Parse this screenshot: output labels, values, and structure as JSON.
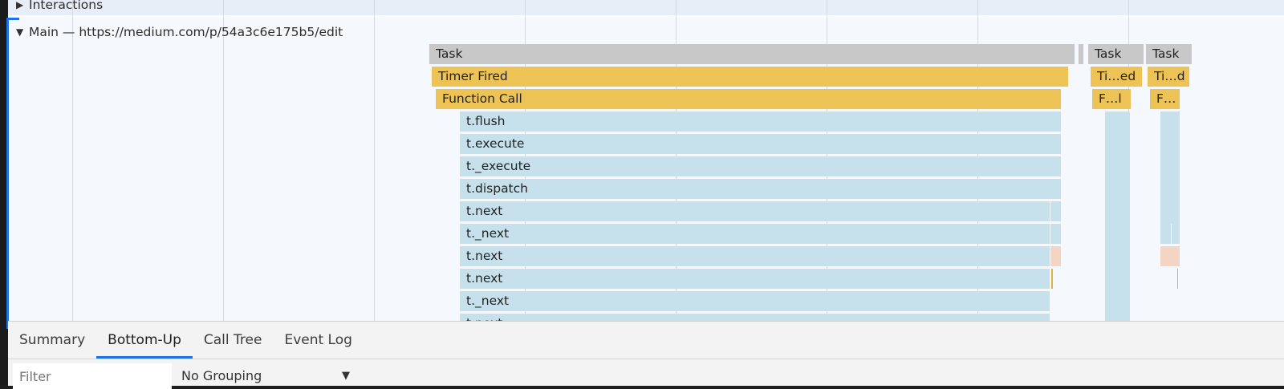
{
  "interactions_track": {
    "arrow": "▶",
    "label": "Interactions"
  },
  "main_track": {
    "arrow": "▼",
    "label": "Main — https://medium.com/p/54a3c6e175b5/edit"
  },
  "flame_labels": {
    "task": "Task",
    "timer_fired": "Timer Fired",
    "function_call": "Function Call",
    "stack": [
      "t.flush",
      "t.execute",
      "t._execute",
      "t.dispatch",
      "t.next",
      "t._next",
      "t.next",
      "t.next",
      "t._next",
      "t.next"
    ],
    "task_2": "Task",
    "timer_fired_2": "Ti…ed",
    "function_call_2": "F…l",
    "task_3": "Task",
    "timer_fired_3": "Ti…d",
    "function_call_3": "F…"
  },
  "colors": {
    "task": "#c8c8c8",
    "scripting": "#eec356",
    "js_frame": "#c6e1ec",
    "gc": "#f2d5c2",
    "accent": "#1a73e8"
  },
  "bottom_panel": {
    "tabs": [
      {
        "label": "Summary"
      },
      {
        "label": "Bottom-Up",
        "active": true
      },
      {
        "label": "Call Tree"
      },
      {
        "label": "Event Log"
      }
    ],
    "filter_placeholder": "Filter",
    "grouping": "No Grouping",
    "grouping_arrow": "▼"
  }
}
